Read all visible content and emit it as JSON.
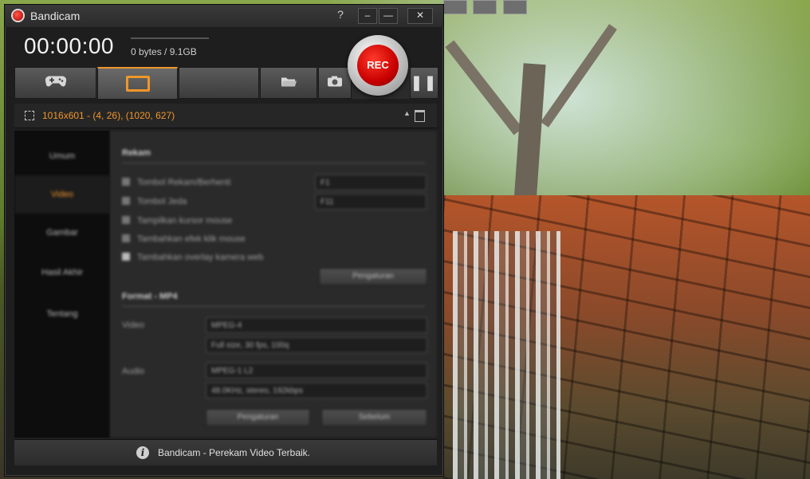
{
  "window": {
    "title": "Bandicam",
    "help_label": "?",
    "minimize_label": "–",
    "minimize2_label": "—",
    "close_label": "✕"
  },
  "recording": {
    "timer": "00:00:00",
    "size": "0 bytes / 9.1GB",
    "rec_label": "REC"
  },
  "modes": [
    {
      "name": "game",
      "icon": "gamepad-icon",
      "active": false
    },
    {
      "name": "screen-rectangle",
      "icon": "rectangle-icon",
      "active": true
    },
    {
      "name": "device",
      "icon": "",
      "active": false
    },
    {
      "name": "folder",
      "icon": "folder-icon",
      "active": false
    },
    {
      "name": "screenshot",
      "icon": "camera-icon",
      "active": false
    },
    {
      "name": "pause",
      "icon": "pause-icon",
      "active": false
    }
  ],
  "region": {
    "text": "1016x601 - (4, 26), (1020, 627)"
  },
  "sidebar": {
    "items": [
      {
        "label": "Umum"
      },
      {
        "label": "Video"
      },
      {
        "label": "Gambar"
      },
      {
        "label": "Hasil Akhir"
      },
      {
        "label": "Tentang"
      }
    ]
  },
  "record_section": {
    "title": "Rekam",
    "options": [
      {
        "label": "Tombol Rekam/Berhenti"
      },
      {
        "label": "Tombol Jeda"
      },
      {
        "label": "Tampilkan kursor mouse"
      },
      {
        "label": "Tambahkan efek klik mouse"
      },
      {
        "label": "Tambahkan overlay kamera web"
      }
    ],
    "hotkey_record": "F1",
    "hotkey_pause": "F11",
    "settings_button": "Pengaturan"
  },
  "format_section": {
    "title": "Format - MP4",
    "video_label": "Video",
    "video_codec": "MPEG-4",
    "video_detail": "Full size, 30 fps, 100q",
    "audio_label": "Audio",
    "audio_codec": "MPEG-1 L2",
    "audio_detail": "48.0KHz, stereo, 192kbps",
    "settings_button": "Pengaturan",
    "presets_button": "Sebelum"
  },
  "status": {
    "info_icon": "i",
    "text": "Bandicam - Perekam Video Terbaik."
  },
  "colors": {
    "accent": "#f0962a",
    "rec_red": "#c80000",
    "window_bg": "#1e1e1e"
  }
}
